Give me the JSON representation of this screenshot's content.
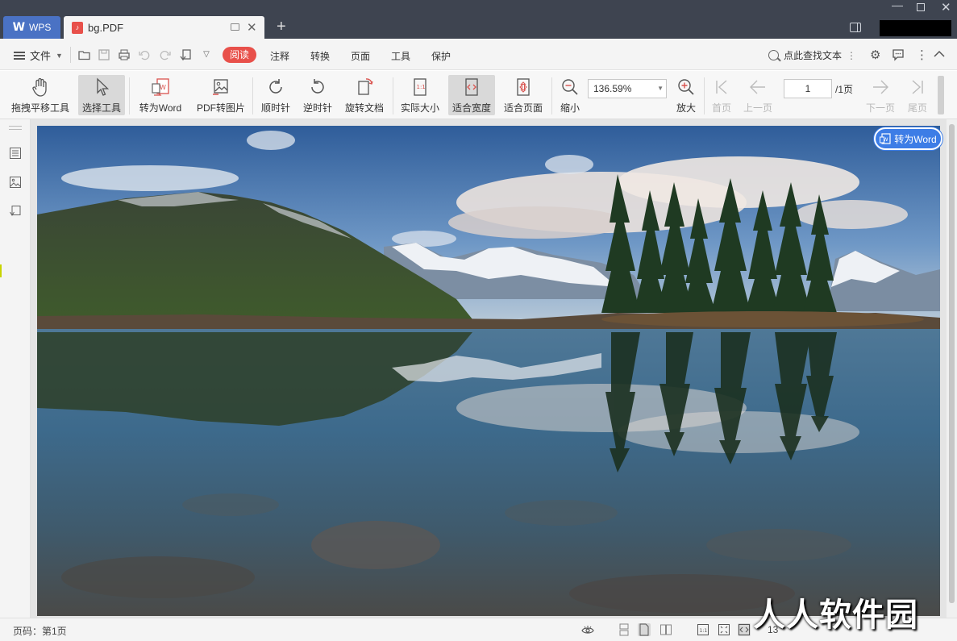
{
  "titlebar": {
    "tab_wps": "WPS",
    "tab_wps_logo": "W",
    "tab_doc": "bg.PDF",
    "tab_doc_icon": "pdf-icon"
  },
  "menubar": {
    "file": "文件",
    "read": "阅读",
    "items": [
      "注释",
      "转换",
      "页面",
      "工具",
      "保护"
    ],
    "search": "点此查找文本"
  },
  "toolbar": {
    "hand": "拖拽平移工具",
    "select": "选择工具",
    "to_word": "转为Word",
    "pdf_to_image": "PDF转图片",
    "clockwise": "顺时针",
    "counter_clockwise": "逆时针",
    "rotate_doc": "旋转文档",
    "actual_size": "实际大小",
    "fit_width": "适合宽度",
    "fit_page": "适合页面",
    "zoom_out": "缩小",
    "zoom_value": "136.59%",
    "zoom_in": "放大",
    "first_page": "首页",
    "prev_page": "上一页",
    "page_current": "1",
    "page_total": "/1页",
    "next_page": "下一页",
    "last_page": "尾页"
  },
  "document": {
    "convert_button": "转为Word"
  },
  "statusbar": {
    "page_label": "页码：第1页",
    "zoom": "13"
  },
  "watermark": "人人软件园"
}
